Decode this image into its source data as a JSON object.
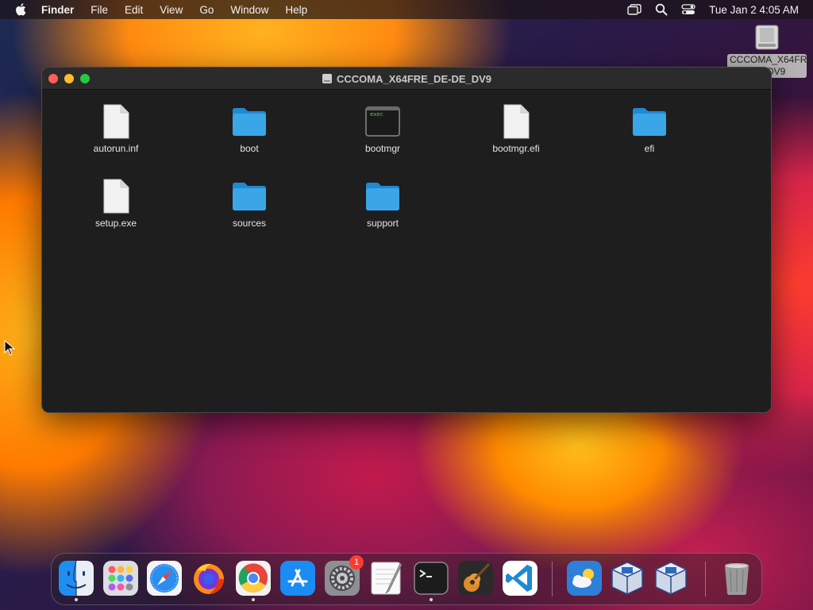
{
  "menubar": {
    "app_name": "Finder",
    "items": [
      "File",
      "Edit",
      "View",
      "Go",
      "Window",
      "Help"
    ],
    "clock": "Tue Jan 2  4:05 AM",
    "status_icons": [
      "screen-mirroring-icon",
      "spotlight-search-icon",
      "control-center-icon"
    ]
  },
  "desktop": {
    "volume_label": "CCCOMA_X64FRE_DE-DE_DV9"
  },
  "window": {
    "title": "CCCOMA_X64FRE_DE-DE_DV9",
    "items": [
      {
        "name": "autorun.inf",
        "kind": "document"
      },
      {
        "name": "boot",
        "kind": "folder"
      },
      {
        "name": "bootmgr",
        "kind": "exec"
      },
      {
        "name": "bootmgr.efi",
        "kind": "document"
      },
      {
        "name": "efi",
        "kind": "folder"
      },
      {
        "name": "setup.exe",
        "kind": "document"
      },
      {
        "name": "sources",
        "kind": "folder"
      },
      {
        "name": "support",
        "kind": "folder"
      }
    ],
    "exec_icon_text": "exec"
  },
  "dock": {
    "apps": [
      "Finder",
      "Launchpad",
      "Safari",
      "Firefox",
      "Google Chrome",
      "App Store",
      "System Preferences",
      "TextEdit",
      "Terminal",
      "GarageBand",
      "Visual Studio Code",
      "Weather",
      "VirtualBox",
      "VirtualBox VM",
      "Trash"
    ],
    "system_preferences_badge": "1"
  },
  "colors": {
    "folder_blue": "#3aa6e8",
    "close": "#ff5f57",
    "minimize": "#febc2e",
    "zoom": "#28c840"
  }
}
